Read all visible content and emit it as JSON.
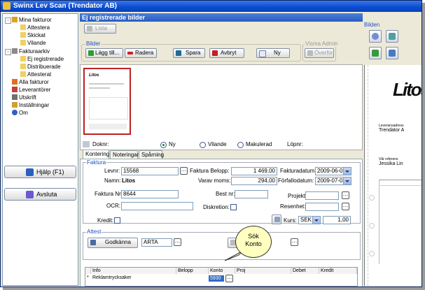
{
  "window": {
    "title": "Swinx Lev Scan (Trendator AB)"
  },
  "tree": {
    "items": [
      {
        "label": "Mina fakturor",
        "level": 0,
        "expander": "-"
      },
      {
        "label": "Attestera",
        "level": 1
      },
      {
        "label": "Skickat",
        "level": 1
      },
      {
        "label": "Vilande",
        "level": 1
      },
      {
        "label": "Fakturaarkiv",
        "level": 0,
        "expander": "-"
      },
      {
        "label": "Ej registrerade",
        "level": 1
      },
      {
        "label": "Distribuerade",
        "level": 1
      },
      {
        "label": "Attesterat",
        "level": 1
      },
      {
        "label": "Alla fakturor",
        "level": 0
      },
      {
        "label": "Leverantörer",
        "level": 0
      },
      {
        "label": "Utskrift",
        "level": 0
      },
      {
        "label": "Inställningar",
        "level": 0
      },
      {
        "label": "Om",
        "level": 0
      }
    ]
  },
  "left_buttons": {
    "help": "Hjälp (F1)",
    "exit": "Avsluta"
  },
  "pane": {
    "title": "Ej registrerade bilder",
    "lista": "Lista"
  },
  "bilder": {
    "group_label": "Bilder",
    "add": "Lägg till...",
    "delete": "Radera",
    "save": "Spara",
    "cancel": "Avbryt",
    "new": "Ny",
    "visma_label": "Visma Admin",
    "transfer": "Överför"
  },
  "thumbnail": {
    "brand": "Litos"
  },
  "dok": {
    "label": "Doknr:",
    "options": [
      "Ny",
      "Vilande",
      "Makulerad"
    ],
    "selected": "Ny",
    "lopnr": "Löpnr:"
  },
  "tabs": [
    "Kontering",
    "Noteringar",
    "Spårning"
  ],
  "faktura": {
    "group_label": "Faktura",
    "levnr_label": "Levnr:",
    "levnr": "15568",
    "namn_label": "Namn:",
    "namn": "Litos",
    "belopp_label": "Faktura Belopp:",
    "belopp": "1 469,00",
    "moms_label": "Varav moms:",
    "moms": "294,00",
    "fakturadatum_label": "Fakturadatum:",
    "fakturadatum": "2009-06-02",
    "forfallodatum_label": "Förfallodatum:",
    "forfallodatum": "2009-07-02",
    "fakturanr_label": "Faktura Nr:",
    "fakturanr": "8644",
    "bestnr_label": "Best nr:",
    "projekt_label": "Projekt:",
    "ocr_label": "OCR:",
    "diskretion_label": "Diskretion:",
    "resenhet_label": "Resenhet:",
    "kredit_label": "Kredit:",
    "kurs_label": "Kurs:",
    "currency": "SEK",
    "rate": "1,00"
  },
  "attest": {
    "group_label": "Attest",
    "approve": "Godkänna",
    "code": "ARTA"
  },
  "grid": {
    "headers": [
      "Info",
      "Belopp",
      "Konto",
      "Proj",
      "Debet",
      "Kredit"
    ],
    "row": {
      "marker": "*",
      "info": "Reklamtrycksaker",
      "konto": "5930"
    }
  },
  "callout": {
    "line1": "Sök",
    "line2": "Konto"
  },
  "preview": {
    "label": "Bilden",
    "brand": "Litos",
    "line1": "Leveransadress",
    "line2": "Trendator A",
    "line3": "Vår referens",
    "line4": "Jessika Lin"
  },
  "colors": {
    "titlebar": "#0a4bd0",
    "accent": "#2050c0",
    "thumb_border": "#b22222"
  }
}
